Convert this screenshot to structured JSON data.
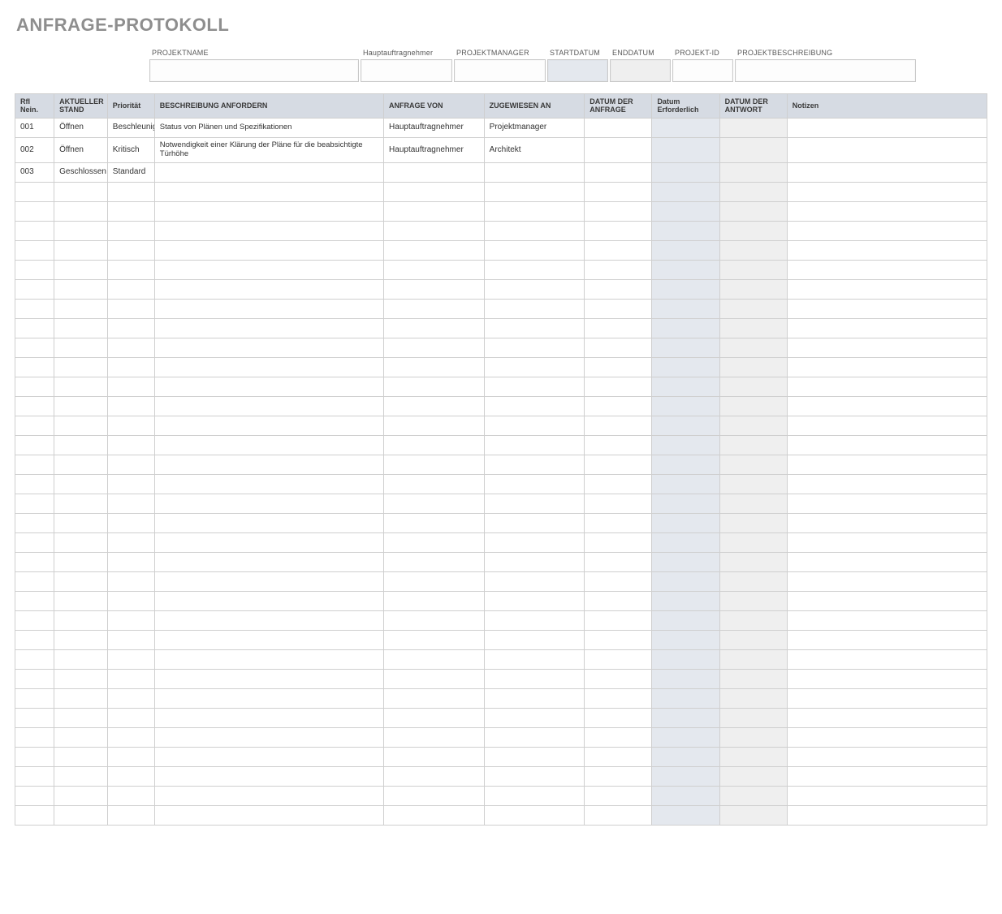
{
  "title": "ANFRAGE-PROTOKOLL",
  "meta": {
    "labels": {
      "project_name": "PROJEKTNAME",
      "main_contractor": "Hauptauftragnehmer",
      "project_manager": "PROJEKTMANAGER",
      "start_date": "STARTDATUM",
      "end_date": "ENDDATUM",
      "project_id": "PROJEKT-ID",
      "project_desc": "PROJEKTBESCHREIBUNG"
    },
    "values": {
      "project_name": "",
      "main_contractor": "",
      "project_manager": "",
      "start_date": "",
      "end_date": "",
      "project_id": "",
      "project_desc": ""
    }
  },
  "table": {
    "headers": {
      "rfi_no": "RfI Nein.",
      "status": "AKTUELLER STAND",
      "priority": "Priorität",
      "description": "BESCHREIBUNG ANFORDERN",
      "request_from": "ANFRAGE VON",
      "assigned_to": "ZUGEWIESEN AN",
      "date_request": "DATUM DER ANFRAGE",
      "date_required": "Datum Erforderlich",
      "date_response": "DATUM DER ANTWORT",
      "notes": "Notizen"
    },
    "rows": [
      {
        "rfi_no": "001",
        "status": "Öffnen",
        "priority": "Beschleunigt",
        "description": "Status von Plänen und Spezifikationen",
        "request_from": "Hauptauftragnehmer",
        "assigned_to": "Projektmanager",
        "date_request": "",
        "date_required": "",
        "date_response": "",
        "notes": ""
      },
      {
        "rfi_no": "002",
        "status": "Öffnen",
        "priority": "Kritisch",
        "description": "Notwendigkeit einer Klärung der Pläne für die beabsichtigte Türhöhe",
        "request_from": "Hauptauftragnehmer",
        "assigned_to": "Architekt",
        "date_request": "",
        "date_required": "",
        "date_response": "",
        "notes": ""
      },
      {
        "rfi_no": "003",
        "status": "Geschlossen",
        "priority": "Standard",
        "description": "",
        "request_from": "",
        "assigned_to": "",
        "date_request": "",
        "date_required": "",
        "date_response": "",
        "notes": ""
      }
    ],
    "empty_row_count": 33
  }
}
